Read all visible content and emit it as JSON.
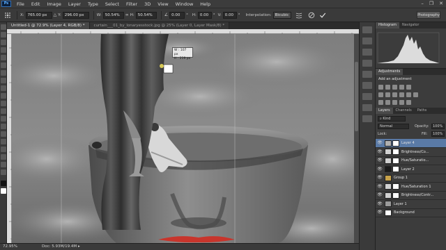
{
  "menu": {
    "logo": "Ps",
    "items": [
      "File",
      "Edit",
      "Image",
      "Layer",
      "Type",
      "Select",
      "Filter",
      "3D",
      "View",
      "Window",
      "Help"
    ]
  },
  "window_controls": {
    "minimize": "–",
    "restore": "❐",
    "close": "✕"
  },
  "options": {
    "x_label": "X:",
    "x_value": "765.00 px",
    "y_label": "Y:",
    "y_value": "296.00 px",
    "w_label": "W:",
    "w_value": "50.54%",
    "h_label": "H:",
    "h_value": "50.54%",
    "angle_value": "0.00",
    "h_skew_label": "H:",
    "h_skew_value": "0.00",
    "v_skew_label": "V:",
    "v_skew_value": "0.00",
    "interp_label": "Interpolation:",
    "interp_value": "Bicubic",
    "workspace": "Photography"
  },
  "tabs": [
    "Untitled-1 @ 72.9% (Layer 4, RGB/8) *",
    "curtain___01_by_lonaryesstock.jpg @ 25% (Layer 0, Layer Mask/8) *"
  ],
  "canvas": {
    "tooltip_w": "W : 107 px",
    "tooltip_h": "H : 219 px"
  },
  "status": {
    "zoom": "72.95%",
    "doc": "Doc: 5.93M/19.4M"
  },
  "panels": {
    "histogram_tab": "Histogram",
    "navigator_tab": "Navigator",
    "adjustments_tab": "Adjustments",
    "add_adjustment": "Add an adjustment",
    "layers_tab": "Layers",
    "channels_tab": "Channels",
    "paths_tab": "Paths",
    "kind_label": "Kind",
    "blend_mode": "Normal",
    "opacity_label": "Opacity:",
    "opacity_value": "100%",
    "lock_label": "Lock:",
    "fill_label": "Fill:",
    "fill_value": "100%"
  },
  "layers": [
    {
      "name": "Layer 4",
      "selected": true,
      "thumb": "#b0b0b0",
      "mask": true
    },
    {
      "name": "Brightness/Co...",
      "selected": false,
      "thumb": "#d0d0d0",
      "mask": true
    },
    {
      "name": "Hue/Saturatio...",
      "selected": false,
      "thumb": "#d0d0d0",
      "mask": true
    },
    {
      "name": "Layer 2",
      "selected": false,
      "thumb": "#1a1a1a",
      "mask": true
    },
    {
      "name": "Group 1",
      "selected": false,
      "thumb": "#c7a24a",
      "mask": false
    },
    {
      "name": "Hue/Saturation 1",
      "selected": false,
      "thumb": "#d0d0d0",
      "mask": true
    },
    {
      "name": "Brightness/Contr...",
      "selected": false,
      "thumb": "#d0d0d0",
      "mask": true
    },
    {
      "name": "Layer 1",
      "selected": false,
      "thumb": "#9a9a9a",
      "mask": false
    },
    {
      "name": "Background",
      "selected": false,
      "thumb": "#ffffff",
      "mask": false
    }
  ]
}
